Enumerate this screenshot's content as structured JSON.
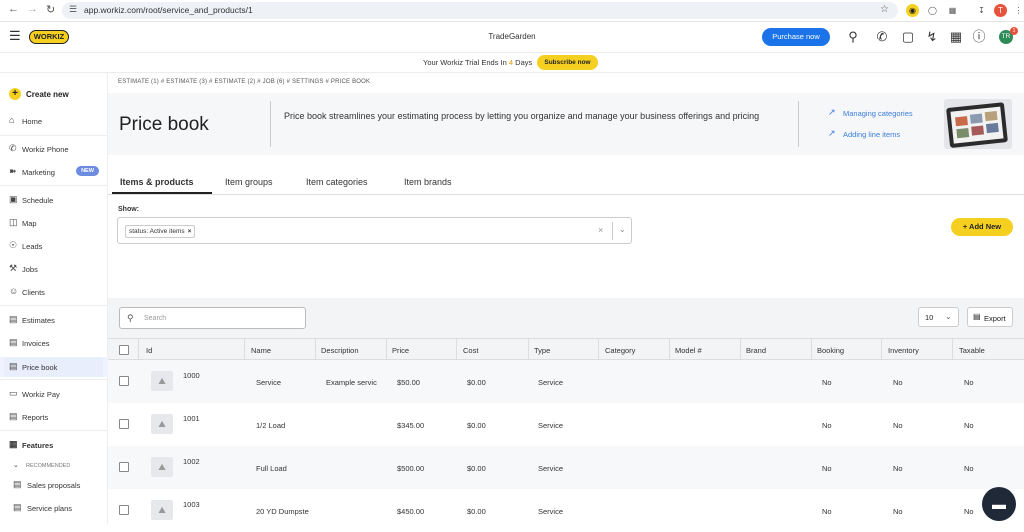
{
  "browser": {
    "url": "app.workiz.com/root/service_and_products/1",
    "profile_initial": "T"
  },
  "appbar": {
    "logo": "WORKIZ",
    "company": "TradeGarden",
    "purchase_label": "Purchase now",
    "avatar_initials": "TR",
    "avatar_badge": "1"
  },
  "trial": {
    "text_before": "Your Workiz Trial Ends In",
    "days": "4",
    "text_after": "Days",
    "subscribe_label": "Subscribe now"
  },
  "sidebar": {
    "create_label": "Create new",
    "items": [
      {
        "label": "Home",
        "icon": "home-icon"
      },
      {
        "label": "Workiz Phone",
        "icon": "phone-icon"
      },
      {
        "label": "Marketing",
        "icon": "megaphone-icon",
        "badge": "NEW"
      },
      {
        "label": "Schedule",
        "icon": "calendar-icon"
      },
      {
        "label": "Map",
        "icon": "map-icon"
      },
      {
        "label": "Leads",
        "icon": "leads-icon"
      },
      {
        "label": "Jobs",
        "icon": "wrench-icon"
      },
      {
        "label": "Clients",
        "icon": "clients-icon"
      },
      {
        "label": "Estimates",
        "icon": "estimate-icon"
      },
      {
        "label": "Invoices",
        "icon": "invoice-icon"
      },
      {
        "label": "Price book",
        "icon": "pricebook-icon"
      },
      {
        "label": "Workiz Pay",
        "icon": "card-icon"
      },
      {
        "label": "Reports",
        "icon": "reports-icon"
      },
      {
        "label": "Features",
        "icon": "grid-icon"
      },
      {
        "label": "RECOMMENDED",
        "icon": "chevron-down-icon"
      },
      {
        "label": "Sales proposals",
        "icon": "document-icon"
      },
      {
        "label": "Service plans",
        "icon": "plan-icon"
      }
    ]
  },
  "page": {
    "breadcrumb": "ESTIMATE (1) # ESTIMATE (3) # ESTIMATE (2) # JOB (6) # SETTINGS # PRICE BOOK",
    "title": "Price book",
    "description": "Price book streamlines your estimating process by letting you organize and manage your business offerings and pricing",
    "links": [
      "Managing categories",
      "Adding line items"
    ],
    "tabs": [
      "Items & products",
      "Item groups",
      "Item categories",
      "Item brands"
    ],
    "show_label": "Show:",
    "filter_chip": "status: Active items",
    "add_new_label": "Add New",
    "search_placeholder": "Search",
    "page_size": "10",
    "export_label": "Export"
  },
  "table": {
    "columns": [
      "Id",
      "Name",
      "Description",
      "Price",
      "Cost",
      "Type",
      "Category",
      "Model #",
      "Brand",
      "Booking",
      "Inventory",
      "Taxable"
    ],
    "rows": [
      {
        "id": "1000",
        "name": "Service",
        "description": "Example servic",
        "price": "$50.00",
        "cost": "$0.00",
        "type": "Service",
        "category": "",
        "model": "",
        "brand": "",
        "booking": "No",
        "inventory": "No",
        "taxable": "No"
      },
      {
        "id": "1001",
        "name": "1/2 Load",
        "description": "",
        "price": "$345.00",
        "cost": "$0.00",
        "type": "Service",
        "category": "",
        "model": "",
        "brand": "",
        "booking": "No",
        "inventory": "No",
        "taxable": "No"
      },
      {
        "id": "1002",
        "name": "Full Load",
        "description": "",
        "price": "$500.00",
        "cost": "$0.00",
        "type": "Service",
        "category": "",
        "model": "",
        "brand": "",
        "booking": "No",
        "inventory": "No",
        "taxable": "No"
      },
      {
        "id": "1003",
        "name": "20 YD Dumpste",
        "description": "",
        "price": "$450.00",
        "cost": "$0.00",
        "type": "Service",
        "category": "",
        "model": "",
        "brand": "",
        "booking": "No",
        "inventory": "No",
        "taxable": "No"
      }
    ]
  },
  "colors": {
    "brand_yellow": "#f5d020",
    "primary_blue": "#1a73e8",
    "link_blue": "#3b7ddd"
  }
}
